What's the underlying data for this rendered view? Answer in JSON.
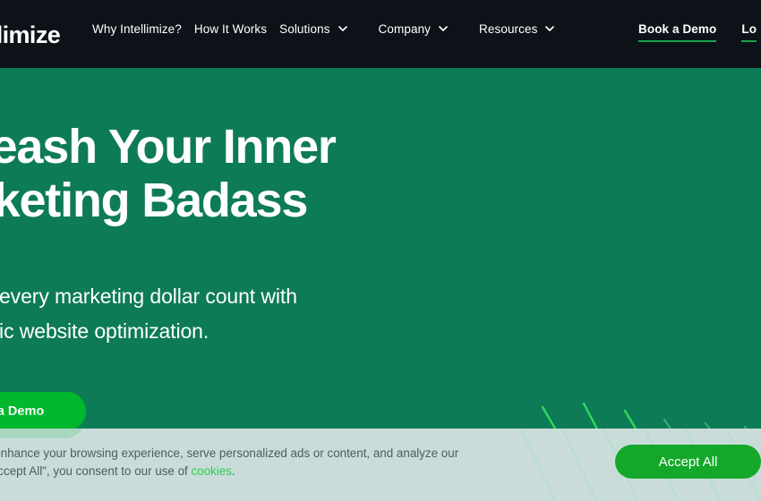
{
  "navbar": {
    "logo_text": "tellimize",
    "links": [
      {
        "label": "Why Intellimize?",
        "has_caret": false
      },
      {
        "label": "How It Works",
        "has_caret": false
      },
      {
        "label": "Solutions",
        "has_caret": true
      },
      {
        "label": "Company",
        "has_caret": true
      },
      {
        "label": "Resources",
        "has_caret": true
      }
    ],
    "cta_label": "Book a Demo",
    "login_label": "Lo",
    "background_color": "#0d1219",
    "underline_color": "#15a349"
  },
  "hero": {
    "headline_line1": "nleash Your Inner",
    "headline_line2": "arketing Badass",
    "sub_line1": "e every marketing dollar count with",
    "sub_line2": "mic website optimization.",
    "cta_label": "k a Demo",
    "background_color": "#0d7b56",
    "cta_color": "#00b82e"
  },
  "cookie_banner": {
    "text_line1": "ookies to enhance your browsing experience, serve personalized ads or content, and analyze our",
    "text_line2_before": "clicking \"Accept All\", you consent to our use of ",
    "link_label": "cookies",
    "text_line2_after": ".",
    "accept_label": "Accept All",
    "background_color": "#c9dcda",
    "accept_color": "#14a82a",
    "link_color": "#2ecc4f"
  }
}
